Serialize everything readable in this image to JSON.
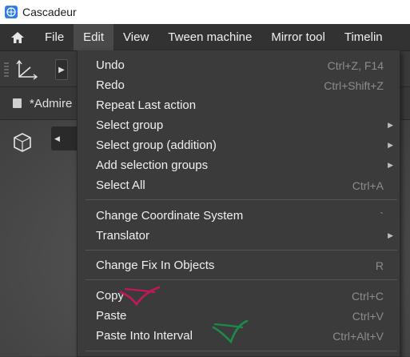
{
  "window": {
    "title": "Cascadeur"
  },
  "menubar": {
    "items": [
      {
        "label": "File"
      },
      {
        "label": "Edit"
      },
      {
        "label": "View"
      },
      {
        "label": "Tween machine"
      },
      {
        "label": "Mirror tool"
      },
      {
        "label": "Timelin"
      }
    ]
  },
  "tab": {
    "name": "*Admire"
  },
  "edit_menu": {
    "items": [
      {
        "label": "Undo",
        "shortcut": "Ctrl+Z, F14"
      },
      {
        "label": "Redo",
        "shortcut": "Ctrl+Shift+Z"
      },
      {
        "label": "Repeat Last action",
        "shortcut": ""
      },
      {
        "label": "Select group",
        "shortcut": ""
      },
      {
        "label": "Select group (addition)",
        "shortcut": ""
      },
      {
        "label": "Add selection groups",
        "shortcut": ""
      },
      {
        "label": "Select All",
        "shortcut": "Ctrl+A"
      },
      {
        "label": "Change Coordinate System",
        "shortcut": "`"
      },
      {
        "label": "Translator",
        "shortcut": ""
      },
      {
        "label": "Change Fix In Objects",
        "shortcut": "R"
      },
      {
        "label": "Copy",
        "shortcut": "Ctrl+C"
      },
      {
        "label": "Paste",
        "shortcut": "Ctrl+V"
      },
      {
        "label": "Paste Into Interval",
        "shortcut": "Ctrl+Alt+V"
      }
    ]
  },
  "icons": {
    "app": "cascadeur-logo-icon",
    "home": "home-icon",
    "axes": "axes-icon",
    "cube": "cube-icon",
    "submenu": "submenu-arrow-icon"
  },
  "colors": {
    "titlebar": "#ffffff",
    "menubar": "#323232",
    "menu_bg": "#3b3b3b",
    "menu_active": "#4a4a4a",
    "shortcut_text": "#8c8c8c",
    "annotation_copy": "#c2185b",
    "annotation_paste_interval": "#1b8a4a"
  }
}
